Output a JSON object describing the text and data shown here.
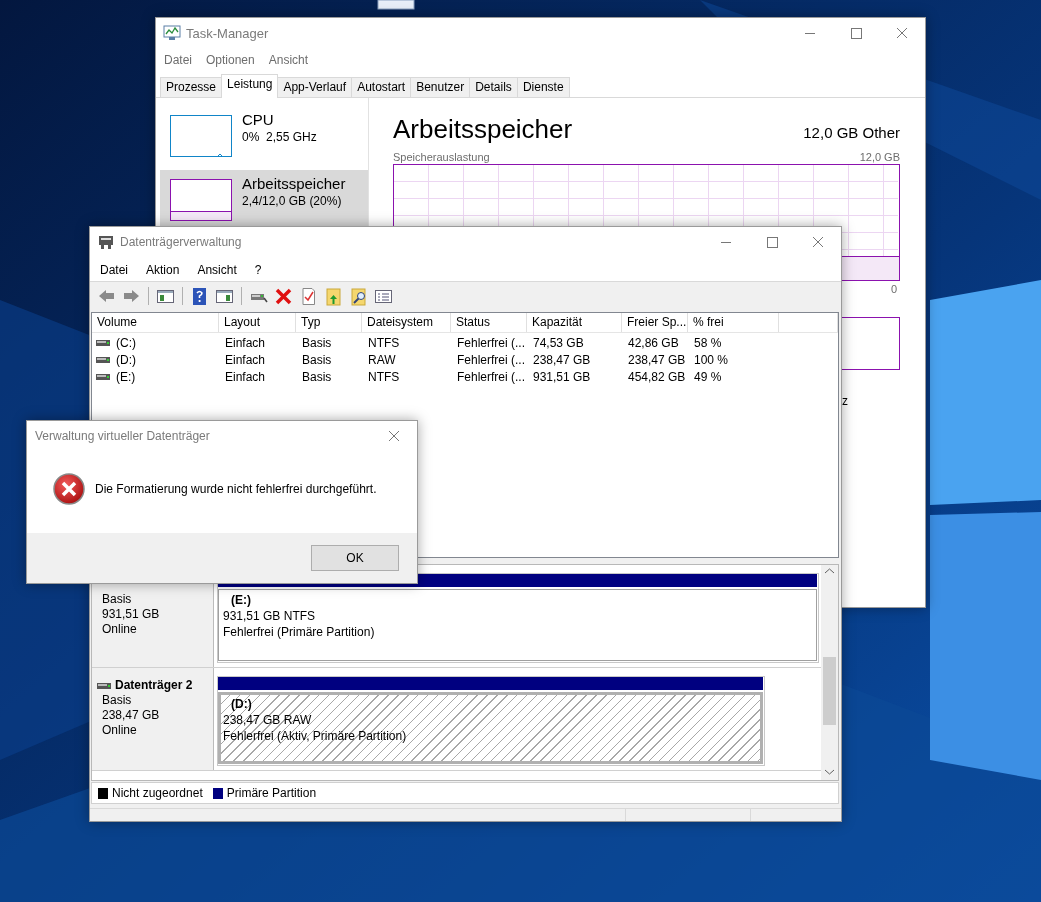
{
  "task_manager": {
    "title": "Task-Manager",
    "menu": [
      "Datei",
      "Optionen",
      "Ansicht"
    ],
    "tabs": [
      {
        "label": "Prozesse",
        "selected": false
      },
      {
        "label": "Leistung",
        "selected": true
      },
      {
        "label": "App-Verlauf",
        "selected": false
      },
      {
        "label": "Autostart",
        "selected": false
      },
      {
        "label": "Benutzer",
        "selected": false
      },
      {
        "label": "Details",
        "selected": false
      },
      {
        "label": "Dienste",
        "selected": false
      }
    ],
    "sidebar": [
      {
        "name": "CPU",
        "detail": "0%  2,55 GHz",
        "selected": false,
        "color": "#1185c8"
      },
      {
        "name": "Arbeitsspeicher",
        "detail": "2,4/12,0 GB (20%)",
        "selected": true,
        "color": "#8b12ae"
      }
    ],
    "heading": "Arbeitsspeicher",
    "capacity": "12,0 GB Other",
    "graph_label": "Speicherauslastung",
    "graph_max": "12,0 GB",
    "graph_min": "0",
    "cut_text": "z"
  },
  "disk_management": {
    "title": "Datenträgerverwaltung",
    "menu": [
      "Datei",
      "Aktion",
      "Ansicht",
      "?"
    ],
    "columns": [
      "Volume",
      "Layout",
      "Typ",
      "Dateisystem",
      "Status",
      "Kapazität",
      "Freier Sp...",
      "% frei"
    ],
    "rows": [
      [
        "(C:)",
        "Einfach",
        "Basis",
        "NTFS",
        "Fehlerfrei (...",
        "74,53 GB",
        "42,86 GB",
        "58 %"
      ],
      [
        "(D:)",
        "Einfach",
        "Basis",
        "RAW",
        "Fehlerfrei (...",
        "238,47 GB",
        "238,47 GB",
        "100 %"
      ],
      [
        "(E:)",
        "Einfach",
        "Basis",
        "NTFS",
        "Fehlerfrei (...",
        "931,51 GB",
        "454,82 GB",
        "49 %"
      ]
    ],
    "disks": [
      {
        "type": "Basis",
        "size": "931,51 GB",
        "state": "Online",
        "partitions": [
          {
            "name": "(E:)",
            "info": "931,51 GB NTFS",
            "status": "Fehlerfrei (Primäre Partition)",
            "selected": false
          }
        ]
      },
      {
        "name": "Datenträger 2",
        "type": "Basis",
        "size": "238,47 GB",
        "state": "Online",
        "partitions": [
          {
            "name": "(D:)",
            "info": "238,47 GB RAW",
            "status": "Fehlerfrei (Aktiv, Primäre Partition)",
            "selected": true
          }
        ]
      }
    ],
    "legend": [
      {
        "label": "Nicht zugeordnet",
        "color": "#000000"
      },
      {
        "label": "Primäre Partition",
        "color": "#000080"
      }
    ]
  },
  "dialog": {
    "title": "Verwaltung virtueller Datenträger",
    "message": "Die Formatierung wurde nicht fehlerfrei durchgeführt.",
    "button": "OK"
  }
}
